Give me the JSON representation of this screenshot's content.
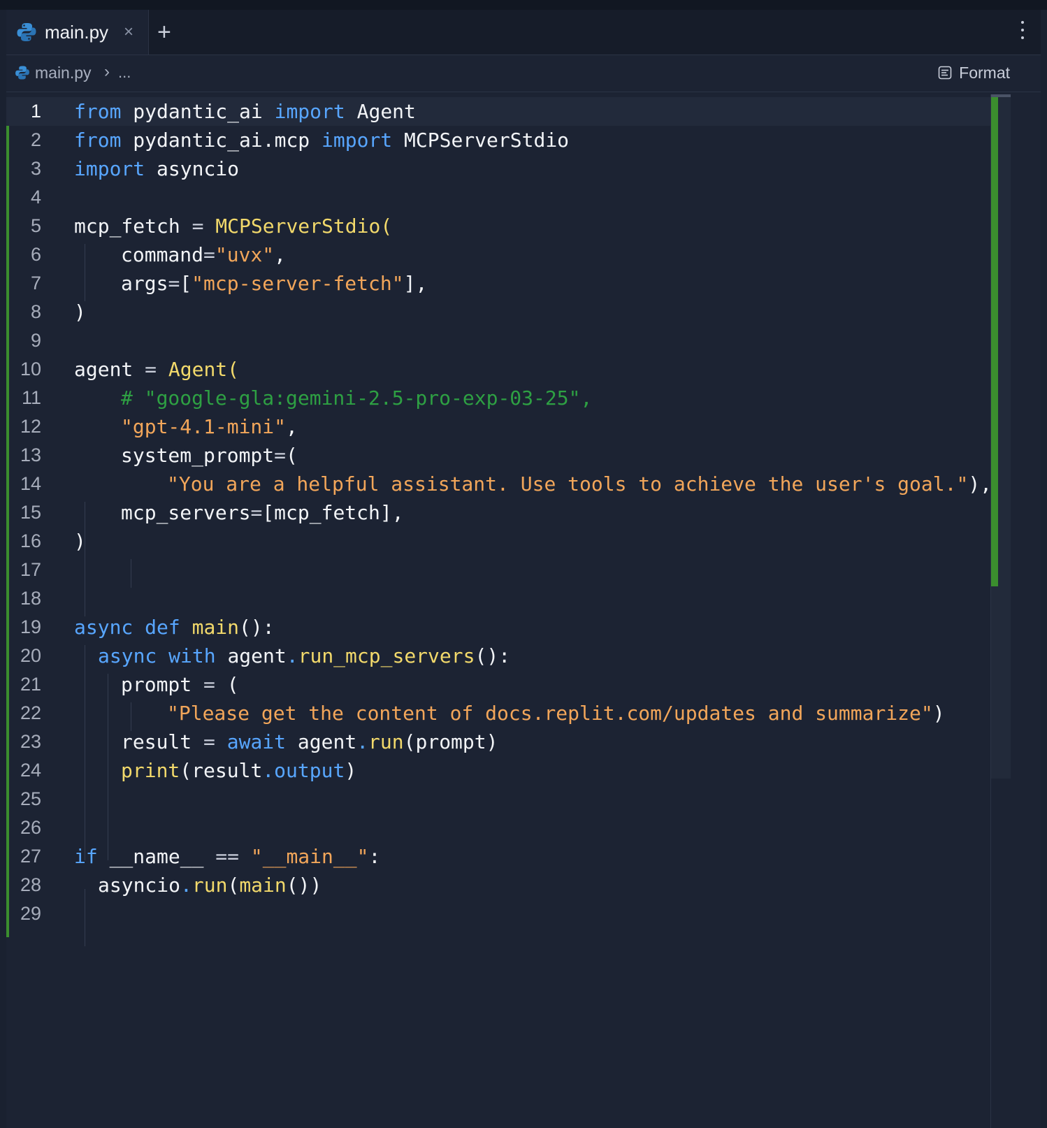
{
  "tab": {
    "filename": "main.py",
    "close_glyph": "×",
    "new_tab_glyph": "+"
  },
  "breadcrumb": {
    "file": "main.py",
    "separator": "›",
    "more": "..."
  },
  "toolbar": {
    "format_label": "Format"
  },
  "editor": {
    "active_line": 1,
    "line_numbers": [
      "1",
      "2",
      "3",
      "4",
      "5",
      "6",
      "7",
      "8",
      "9",
      "10",
      "11",
      "12",
      "13",
      "14",
      "15",
      "16",
      "17",
      "18",
      "19",
      "20",
      "21",
      "22",
      "23",
      "24",
      "25",
      "26",
      "27",
      "28",
      "29"
    ],
    "tokens": {
      "l1": [
        "from",
        " pydantic_ai ",
        "import",
        " Agent"
      ],
      "l2": [
        "from",
        " pydantic_ai.mcp ",
        "import",
        " MCPServerStdio"
      ],
      "l3": [
        "import",
        " asyncio"
      ],
      "l5": [
        "mcp_fetch ",
        "=",
        " ",
        "MCPServerStdio",
        "("
      ],
      "l6": [
        "command",
        "=",
        "\"uvx\"",
        ","
      ],
      "l7": [
        "args",
        "=",
        "[",
        "\"mcp-server-fetch\"",
        "],"
      ],
      "l8": [
        ")"
      ],
      "l10": [
        "agent ",
        "=",
        " ",
        "Agent",
        "("
      ],
      "l11": [
        "# \"google-gla:gemini-2.5-pro-exp-03-25\","
      ],
      "l12": [
        "\"gpt-4.1-mini\"",
        ","
      ],
      "l13": [
        "system_prompt",
        "=",
        "("
      ],
      "l14": [
        "\"You are a helpful assistant. Use tools to achieve the user's goal.\"",
        "),"
      ],
      "l15": [
        "mcp_servers",
        "=",
        "[mcp_fetch],"
      ],
      "l16": [
        ")"
      ],
      "l19": [
        "async",
        " ",
        "def",
        " ",
        "main",
        "():"
      ],
      "l20": [
        "async",
        " ",
        "with",
        " agent",
        ".",
        "run_mcp_servers",
        "():"
      ],
      "l21": [
        "prompt ",
        "=",
        " ("
      ],
      "l22": [
        "\"Please get the content of docs.replit.com/updates and summarize\"",
        ")"
      ],
      "l23": [
        "result ",
        "=",
        " ",
        "await",
        " agent",
        ".",
        "run",
        "(prompt)"
      ],
      "l24": [
        "print",
        "(result",
        ".",
        "output",
        ")"
      ],
      "l27": [
        "if",
        " __name__ ",
        "==",
        " ",
        "\"__main__\"",
        ":"
      ],
      "l28": [
        "asyncio",
        ".",
        "run",
        "(",
        "main",
        "())"
      ]
    }
  },
  "colors": {
    "background": "#1c2333",
    "keyword": "#58a6ff",
    "function": "#f2d96b",
    "string": "#f2a65a",
    "comment": "#2ea043",
    "gutter_change": "#3b8e2e"
  },
  "icons": [
    "python-icon",
    "close-icon",
    "plus-icon",
    "more-vertical-icon",
    "format-icon"
  ]
}
